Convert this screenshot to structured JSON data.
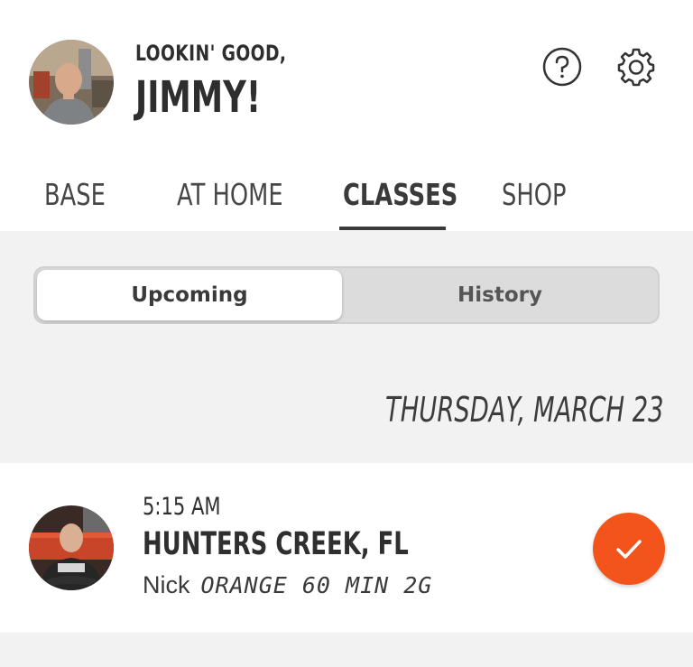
{
  "header": {
    "greeting_line1": "LOOKIN' GOOD,",
    "greeting_line2": "JIMMY!",
    "help_icon": "question-circle-icon",
    "settings_icon": "gear-icon"
  },
  "tabs": [
    {
      "label": "BASE",
      "active": false
    },
    {
      "label": "AT HOME",
      "active": false
    },
    {
      "label": "CLASSES",
      "active": true
    },
    {
      "label": "SHOP",
      "active": false
    }
  ],
  "segmented": {
    "options": [
      {
        "label": "Upcoming",
        "selected": true
      },
      {
        "label": "History",
        "selected": false
      }
    ]
  },
  "date_header": "THURSDAY, MARCH 23",
  "booking": {
    "time": "5:15 AM",
    "studio": "HUNTERS CREEK, FL",
    "coach": "Nick",
    "class_type": "ORANGE 60 MIN 2G",
    "status_icon": "checkmark-icon"
  },
  "colors": {
    "accent": "#f2541b",
    "background": "#f2f2f2",
    "text": "#2e2e2e"
  }
}
